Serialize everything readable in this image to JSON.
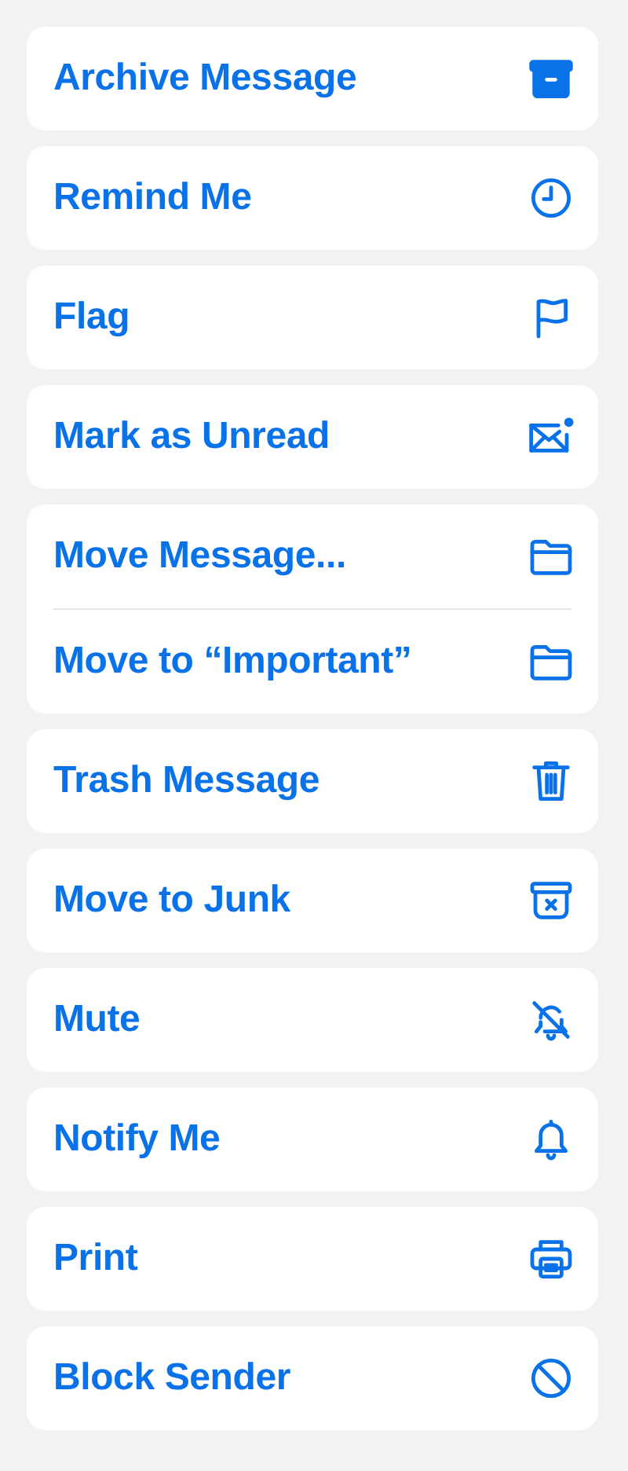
{
  "groups": [
    {
      "items": [
        {
          "label": "Archive Message"
        }
      ]
    },
    {
      "items": [
        {
          "label": "Remind Me"
        }
      ]
    },
    {
      "items": [
        {
          "label": "Flag"
        }
      ]
    },
    {
      "items": [
        {
          "label": "Mark as Unread"
        }
      ]
    },
    {
      "items": [
        {
          "label": "Move Message..."
        },
        {
          "label": "Move to “Important”"
        }
      ]
    },
    {
      "items": [
        {
          "label": "Trash Message"
        }
      ]
    },
    {
      "items": [
        {
          "label": "Move to Junk"
        }
      ]
    },
    {
      "items": [
        {
          "label": "Mute"
        }
      ]
    },
    {
      "items": [
        {
          "label": "Notify Me"
        }
      ]
    },
    {
      "items": [
        {
          "label": "Print"
        }
      ]
    },
    {
      "items": [
        {
          "label": "Block Sender"
        }
      ]
    }
  ]
}
